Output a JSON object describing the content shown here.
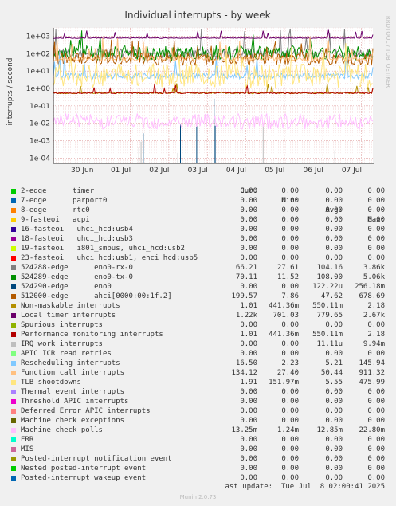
{
  "chart_data": {
    "type": "line",
    "title": "Individual interrupts - by week",
    "ylabel": "interrupts / second",
    "side_label": "RRDTOOL / TOBI OETIKER",
    "scale": "log",
    "ylim": [
      5e-05,
      3000
    ],
    "y_ticks": [
      "1e+03",
      "1e+02",
      "1e+01",
      "1e+00",
      "1e-01",
      "1e-02",
      "1e-03",
      "1e-04"
    ],
    "x_ticks": [
      "30 Jun",
      "01 Jul",
      "02 Jul",
      "03 Jul",
      "04 Jul",
      "05 Jul",
      "06 Jul",
      "07 Jul"
    ],
    "x_range_days": [
      0,
      8.3
    ],
    "x_tick_days": [
      0.75,
      1.75,
      2.75,
      3.75,
      4.75,
      5.75,
      6.75,
      7.75
    ],
    "columns": [
      "Cur:",
      "Min:",
      "Avg:",
      "Max:"
    ],
    "series": [
      {
        "name": "2-edge      timer",
        "color": "#00cc00",
        "cur": "0.00",
        "min": "0.00",
        "avg": "0.00",
        "max": "0.00"
      },
      {
        "name": "7-edge      parport0",
        "color": "#0066b3",
        "cur": "0.00",
        "min": "0.00",
        "avg": "0.00",
        "max": "0.00"
      },
      {
        "name": "8-edge      rtc0",
        "color": "#ff8000",
        "cur": "0.00",
        "min": "0.00",
        "avg": "0.00",
        "max": "0.00"
      },
      {
        "name": "9-fasteoi   acpi",
        "color": "#ffcc00",
        "cur": "0.00",
        "min": "0.00",
        "avg": "0.00",
        "max": "0.00"
      },
      {
        "name": "16-fasteoi   uhci_hcd:usb4",
        "color": "#330099",
        "cur": "0.00",
        "min": "0.00",
        "avg": "0.00",
        "max": "0.00"
      },
      {
        "name": "18-fasteoi   uhci_hcd:usb3",
        "color": "#990099",
        "cur": "0.00",
        "min": "0.00",
        "avg": "0.00",
        "max": "0.00"
      },
      {
        "name": "19-fasteoi   i801_smbus, uhci_hcd:usb2",
        "color": "#ccff00",
        "cur": "0.00",
        "min": "0.00",
        "avg": "0.00",
        "max": "0.00"
      },
      {
        "name": "23-fasteoi   uhci_hcd:usb1, ehci_hcd:usb5",
        "color": "#ff0000",
        "cur": "0.00",
        "min": "0.00",
        "avg": "0.00",
        "max": "0.00"
      },
      {
        "name": "524288-edge      eno0-rx-0",
        "color": "#808080",
        "cur": "66.21",
        "min": "27.61",
        "avg": "104.16",
        "max": "3.86k"
      },
      {
        "name": "524289-edge      eno0-tx-0",
        "color": "#008f00",
        "cur": "70.11",
        "min": "11.52",
        "avg": "108.00",
        "max": "5.06k"
      },
      {
        "name": "524290-edge      eno0",
        "color": "#00487d",
        "cur": "0.00",
        "min": "0.00",
        "avg": "122.22u",
        "max": "256.18m"
      },
      {
        "name": "512000-edge      ahci[0000:00:1f.2]",
        "color": "#b35a00",
        "cur": "199.57",
        "min": "7.86",
        "avg": "47.62",
        "max": "678.69"
      },
      {
        "name": "Non-maskable interrupts",
        "color": "#b38f00",
        "cur": "1.01",
        "min": "441.36m",
        "avg": "550.11m",
        "max": "2.18"
      },
      {
        "name": "Local timer interrupts",
        "color": "#6b006b",
        "cur": "1.22k",
        "min": "701.03",
        "avg": "779.65",
        "max": "2.67k"
      },
      {
        "name": "Spurious interrupts",
        "color": "#8fb300",
        "cur": "0.00",
        "min": "0.00",
        "avg": "0.00",
        "max": "0.00"
      },
      {
        "name": "Performance monitoring interrupts",
        "color": "#b30000",
        "cur": "1.01",
        "min": "441.36m",
        "avg": "550.11m",
        "max": "2.18"
      },
      {
        "name": "IRQ work interrupts",
        "color": "#bebebe",
        "cur": "0.00",
        "min": "0.00",
        "avg": "11.11u",
        "max": "9.94m"
      },
      {
        "name": "APIC ICR read retries",
        "color": "#80ff80",
        "cur": "0.00",
        "min": "0.00",
        "avg": "0.00",
        "max": "0.00"
      },
      {
        "name": "Rescheduling interrupts",
        "color": "#80c9ff",
        "cur": "16.50",
        "min": "2.23",
        "avg": "5.21",
        "max": "145.94"
      },
      {
        "name": "Function call interrupts",
        "color": "#ffc080",
        "cur": "134.12",
        "min": "27.40",
        "avg": "50.44",
        "max": "911.32"
      },
      {
        "name": "TLB shootdowns",
        "color": "#ffe680",
        "cur": "1.91",
        "min": "151.97m",
        "avg": "5.55",
        "max": "475.99"
      },
      {
        "name": "Thermal event interrupts",
        "color": "#aa80ff",
        "cur": "0.00",
        "min": "0.00",
        "avg": "0.00",
        "max": "0.00"
      },
      {
        "name": "Threshold APIC interrupts",
        "color": "#ee00cc",
        "cur": "0.00",
        "min": "0.00",
        "avg": "0.00",
        "max": "0.00"
      },
      {
        "name": "Deferred Error APIC interrupts",
        "color": "#ff8080",
        "cur": "0.00",
        "min": "0.00",
        "avg": "0.00",
        "max": "0.00"
      },
      {
        "name": "Machine check exceptions",
        "color": "#666600",
        "cur": "0.00",
        "min": "0.00",
        "avg": "0.00",
        "max": "0.00"
      },
      {
        "name": "Machine check polls",
        "color": "#ffbfff",
        "cur": "13.25m",
        "min": "1.24m",
        "avg": "12.85m",
        "max": "22.80m"
      },
      {
        "name": "ERR",
        "color": "#00ffcc",
        "cur": "0.00",
        "min": "0.00",
        "avg": "0.00",
        "max": "0.00"
      },
      {
        "name": "MIS",
        "color": "#cc6699",
        "cur": "0.00",
        "min": "0.00",
        "avg": "0.00",
        "max": "0.00"
      },
      {
        "name": "Posted-interrupt notification event",
        "color": "#999900",
        "cur": "0.00",
        "min": "0.00",
        "avg": "0.00",
        "max": "0.00"
      },
      {
        "name": "Nested posted-interrupt event",
        "color": "#00cc00",
        "cur": "0.00",
        "min": "0.00",
        "avg": "0.00",
        "max": "0.00"
      },
      {
        "name": "Posted-interrupt wakeup event",
        "color": "#0066b3",
        "cur": "0.00",
        "min": "0.00",
        "avg": "0.00",
        "max": "0.00"
      }
    ]
  },
  "footer": "Last update:  Tue Jul  8 02:00:41 2025",
  "generator": "Munin 2.0.73"
}
